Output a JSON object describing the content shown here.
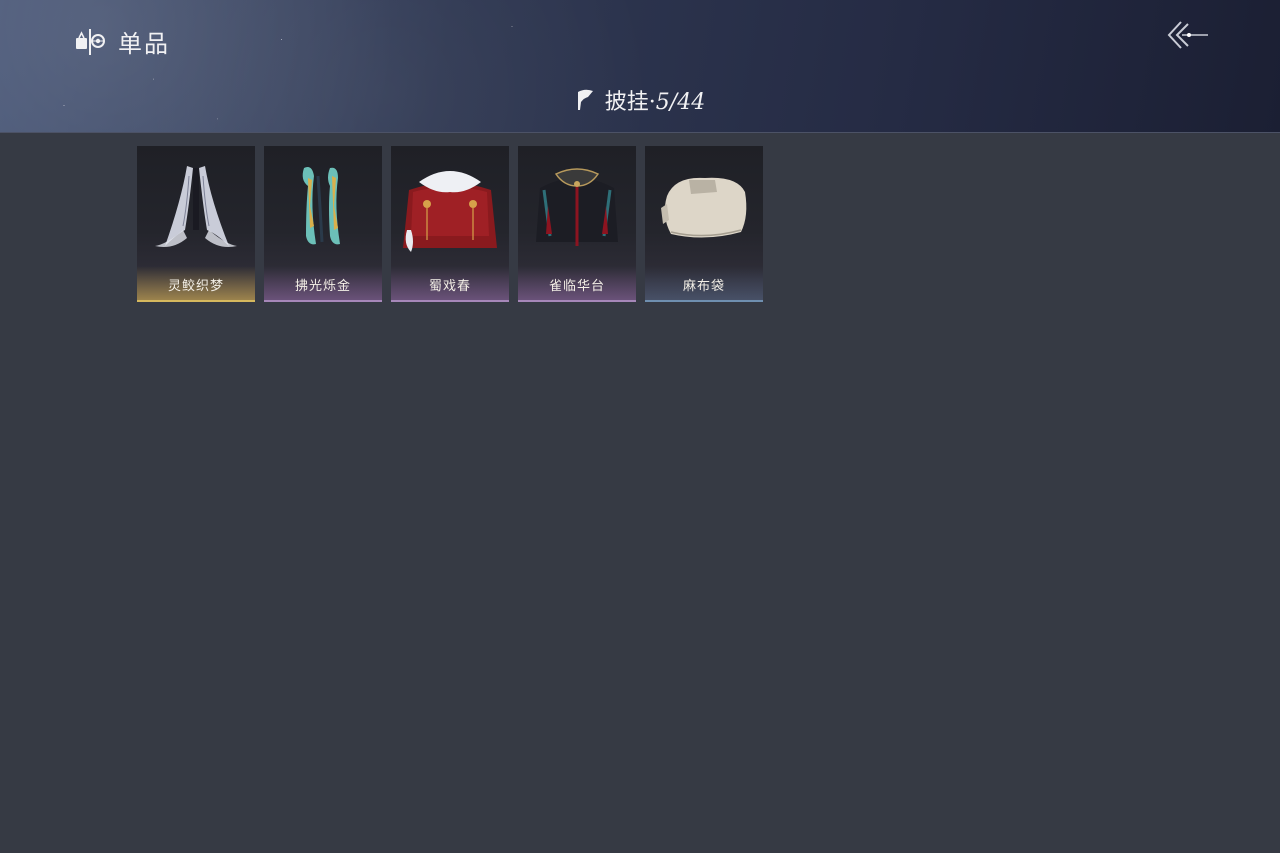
{
  "header": {
    "title": "单品",
    "title_icon": "wardrobe-icon",
    "back_icon": "back-arrow-icon"
  },
  "subheader": {
    "icon": "cape-icon",
    "category": "披挂",
    "separator": "·",
    "count": "5/44"
  },
  "items": [
    {
      "name": "灵鲛织梦",
      "rarity": "gold",
      "icon": "white-silk-cape-icon"
    },
    {
      "name": "拂光烁金",
      "rarity": "purple",
      "icon": "teal-gold-ribbon-icon"
    },
    {
      "name": "蜀戏春",
      "rarity": "purple",
      "icon": "red-fur-cape-icon"
    },
    {
      "name": "雀临华台",
      "rarity": "purple",
      "icon": "black-phoenix-cape-icon"
    },
    {
      "name": "麻布袋",
      "rarity": "blue",
      "icon": "burlap-sack-icon"
    }
  ],
  "colors": {
    "background": "#363a44",
    "gold": "#d6b85e",
    "purple": "#a687b9",
    "blue": "#6f8fb0"
  }
}
